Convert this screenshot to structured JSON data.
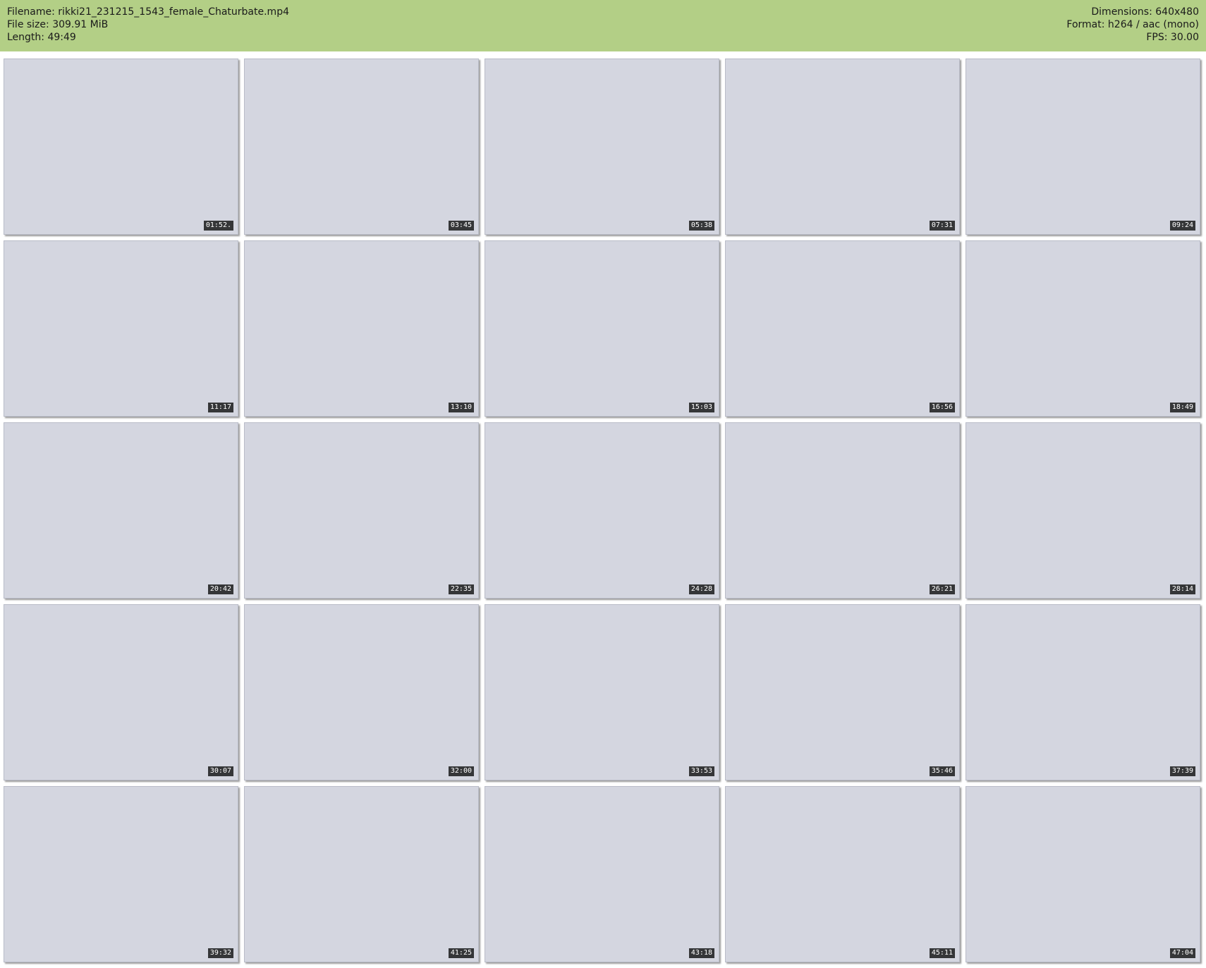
{
  "header": {
    "filename": "Filename: rikki21_231215_1543_female_Chaturbate.mp4",
    "file_size": "File size: 309.91 MiB",
    "length": "Length: 49:49",
    "dimensions": "Dimensions: 640x480",
    "format": "Format: h264 / aac (mono)",
    "fps": "FPS: 30.00"
  },
  "thumbnails": [
    "01:52.",
    "03:45",
    "05:38",
    "07:31",
    "09:24",
    "11:17",
    "13:10",
    "15:03",
    "16:56",
    "18:49",
    "20:42",
    "22:35",
    "24:28",
    "26:21",
    "28:14",
    "30:07",
    "32:00",
    "33:53",
    "35:46",
    "37:39",
    "39:32",
    "41:25",
    "43:18",
    "45:11",
    "47:04"
  ],
  "colors": {
    "header_bg": "#b3cf86"
  }
}
